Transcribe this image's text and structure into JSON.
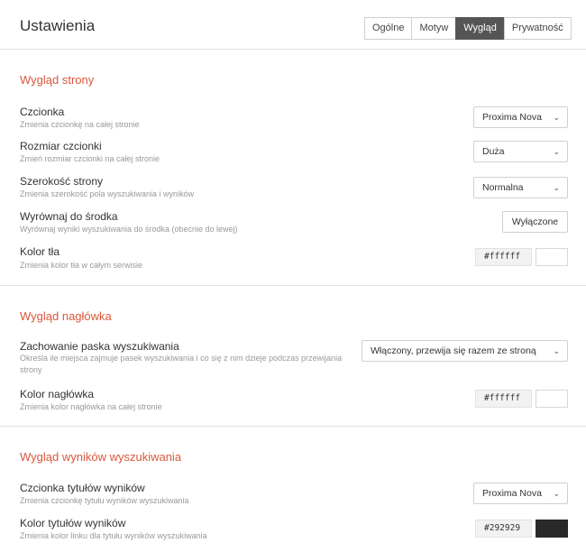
{
  "header": {
    "title": "Ustawienia",
    "tabs": [
      {
        "label": "Ogólne"
      },
      {
        "label": "Motyw"
      },
      {
        "label": "Wygląd"
      },
      {
        "label": "Prywatność"
      }
    ]
  },
  "sections": {
    "page": {
      "title": "Wygląd strony",
      "font": {
        "label": "Czcionka",
        "desc": "Zmienia czcionkę na całej stronie",
        "value": "Proxima Nova"
      },
      "font_size": {
        "label": "Rozmiar czcionki",
        "desc": "Zmień rozmiar czcionki na całej stronie",
        "value": "Duża"
      },
      "page_width": {
        "label": "Szerokość strony",
        "desc": "Zmienia szerokość pola wyszukiwania i wyników",
        "value": "Normalna"
      },
      "center": {
        "label": "Wyrównaj do środka",
        "desc": "Wyrównaj wyniki wyszukiwania do środka (obecnie do lewej)",
        "value": "Wyłączone"
      },
      "bg_color": {
        "label": "Kolor tła",
        "desc": "Zmienia kolor tła w całym serwisie",
        "value": "#ffffff",
        "swatch": "#ffffff"
      }
    },
    "header": {
      "title": "Wygląd nagłówka",
      "search_bar": {
        "label": "Zachowanie paska wyszukiwania",
        "desc": "Określa ile miejsca zajmuje pasek wyszukiwania i co się z nim dzieje podczas przewijania strony",
        "value": "Włączony, przewija się razem ze stroną"
      },
      "header_color": {
        "label": "Kolor nagłówka",
        "desc": "Zmienia kolor nagłówka na całej stronie",
        "value": "#ffffff",
        "swatch": "#ffffff"
      }
    },
    "results": {
      "title": "Wygląd wyników wyszukiwania",
      "title_font": {
        "label": "Czcionka tytułów wyników",
        "desc": "Zmienia czcionkę tytułu wyników wyszukiwania",
        "value": "Proxima Nova"
      },
      "title_color": {
        "label": "Kolor tytułów wyników",
        "desc": "Zmienia kolor linku dla tytułu wyników wyszukiwania",
        "value": "#292929",
        "swatch": "#292929"
      }
    }
  },
  "colors": {
    "accent": "#d9583c",
    "active_tab": "#555555"
  }
}
